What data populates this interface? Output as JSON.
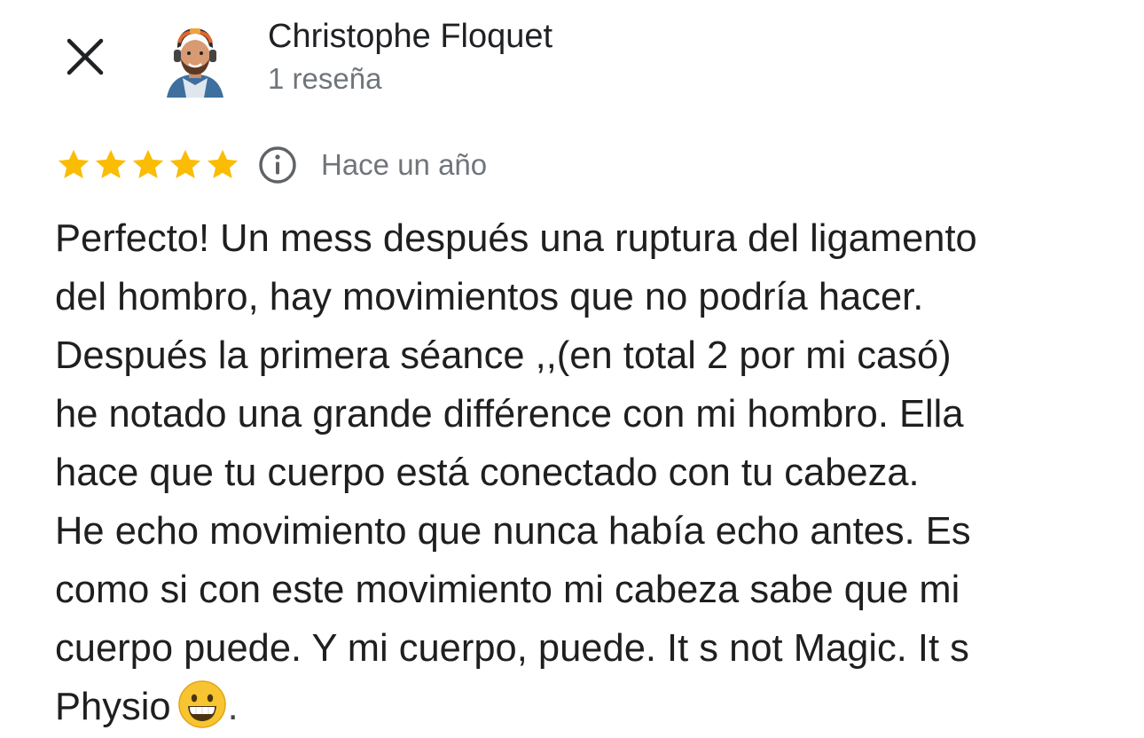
{
  "header": {
    "close_icon": "close-icon",
    "reviewer_name": "Christophe Floquet",
    "review_count": "1 reseña",
    "avatar_icon": "avatar"
  },
  "rating": {
    "stars": 5,
    "max_stars": 5,
    "star_color": "#fbbc04",
    "info_icon": "info-icon",
    "date": "Hace un año"
  },
  "review": {
    "lines": [
      "Perfecto! Un mess después una ruptura del ligamento",
      "del hombro, hay movimientos que no podría hacer.",
      "Después la primera séance ,,(en total 2 por mi casó)",
      "he notado una grande différence con mi hombro. Ella",
      "hace que tu cuerpo está conectado con tu cabeza.",
      "He echo movimiento que nunca había echo antes. Es",
      "como si con este movimiento mi cabeza sabe que mi",
      "cuerpo puede. Y mi cuerpo, puede. It s not Magic. It s",
      "Physio"
    ],
    "emoji_icon": "grinning-face-icon",
    "trailing": "."
  },
  "colors": {
    "text_primary": "#1f1f1f",
    "text_secondary": "#70757a",
    "star": "#fbbc04"
  }
}
